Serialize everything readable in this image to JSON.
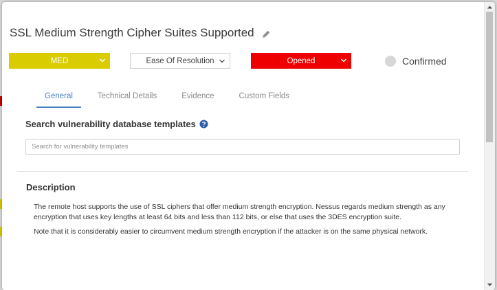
{
  "issue": {
    "title": "SSL Medium Strength Cipher Suites Supported"
  },
  "controls": {
    "severity": {
      "value": "MED",
      "color": "#d9cc00"
    },
    "resolution": {
      "value": "Ease Of Resolution"
    },
    "status": {
      "value": "Opened",
      "color": "#ee0000"
    },
    "confirmed_label": "Confirmed"
  },
  "tabs": [
    {
      "label": "General",
      "active": true
    },
    {
      "label": "Technical Details",
      "active": false
    },
    {
      "label": "Evidence",
      "active": false
    },
    {
      "label": "Custom Fields",
      "active": false
    }
  ],
  "template_search": {
    "heading": "Search vulnerability database templates",
    "placeholder": "Search for vulnerability templates"
  },
  "description": {
    "heading": "Description",
    "paragraphs": [
      "The remote host supports the use of SSL ciphers that offer medium strength encryption. Nessus regards medium strength as any encryption that uses key lengths at least 64 bits and less than 112 bits, or else that uses the 3DES encryption suite.",
      "Note that it is considerably easier to circumvent medium strength encryption if the attacker is on the same physical network."
    ]
  },
  "icons": {
    "edit": "pencil-icon",
    "help": "question-circle-icon",
    "dropdown": "chevron-down-icon"
  },
  "colors": {
    "accent": "#4a7fc1"
  }
}
